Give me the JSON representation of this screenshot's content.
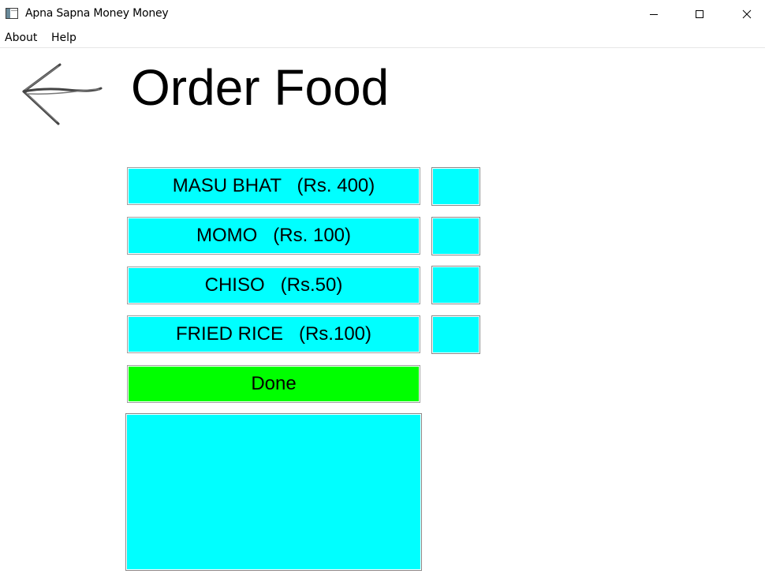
{
  "window": {
    "title": "Apna Sapna Money Money"
  },
  "menu": {
    "about": "About",
    "help": "Help"
  },
  "page": {
    "title": "Order Food"
  },
  "items": [
    {
      "label": "MASU BHAT   (Rs. 400)",
      "quantity": ""
    },
    {
      "label": "MOMO   (Rs. 100)",
      "quantity": ""
    },
    {
      "label": "CHISO   (Rs.50)",
      "quantity": ""
    },
    {
      "label": "FRIED RICE   (Rs.100)",
      "quantity": ""
    }
  ],
  "done_button": {
    "label": "Done"
  },
  "output": {
    "text": ""
  },
  "colors": {
    "item_button": "#00ffff",
    "done_button": "#00ff00",
    "background": "#ffffff"
  },
  "icons": {
    "app": "app-window-icon",
    "back": "back-arrow-icon",
    "minimize": "minimize-icon",
    "maximize": "maximize-icon",
    "close": "close-icon"
  }
}
